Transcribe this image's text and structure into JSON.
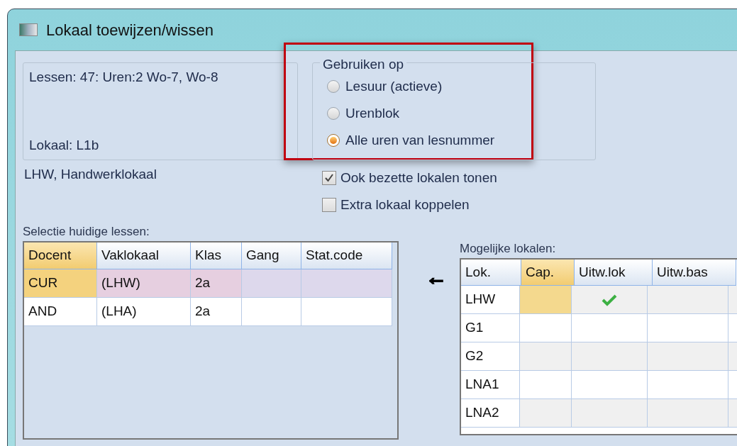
{
  "window": {
    "title": "Lokaal toewijzen/wissen"
  },
  "info": {
    "lessons": "Lessen: 47: Uren:2 Wo-7, Wo-8",
    "room": "Lokaal: L1b",
    "room_description": "LHW, Handwerklokaal"
  },
  "apply_group": {
    "legend": "Gebruiken op",
    "highlighted": true,
    "options": [
      {
        "label": "Lesuur (actieve)",
        "selected": false
      },
      {
        "label": "Urenblok",
        "selected": false
      },
      {
        "label": "Alle uren van lesnummer",
        "selected": true
      }
    ]
  },
  "checkboxes": [
    {
      "label": "Ook bezette lokalen tonen",
      "checked": true
    },
    {
      "label": "Extra lokaal koppelen",
      "checked": false
    }
  ],
  "current_lessons": {
    "label": "Selectie huidige lessen:",
    "columns": [
      {
        "label": "Docent",
        "sorted": true
      },
      {
        "label": "Vaklokaal",
        "sorted": false
      },
      {
        "label": "Klas",
        "sorted": false
      },
      {
        "label": "Gang",
        "sorted": false
      },
      {
        "label": "Stat.code",
        "sorted": false
      }
    ],
    "rows": [
      {
        "cells": [
          "CUR",
          "(LHW)",
          "2a",
          "",
          ""
        ],
        "selected": true
      },
      {
        "cells": [
          "AND",
          "(LHA)",
          "2a",
          "",
          ""
        ],
        "selected": false
      }
    ]
  },
  "transfer_arrow": "←",
  "possible_rooms": {
    "label": "Mogelijke lokalen:",
    "columns": [
      {
        "label": "Lok.",
        "sorted": false
      },
      {
        "label": "Cap.",
        "sorted": true
      },
      {
        "label": "Uitw.lok",
        "sorted": false
      },
      {
        "label": "Uitw.bas",
        "sorted": false
      }
    ],
    "rows": [
      {
        "room": "LHW",
        "current": true,
        "uitw_lok": true
      },
      {
        "room": "G1",
        "current": false,
        "uitw_lok": false
      },
      {
        "room": "G2",
        "current": false,
        "uitw_lok": false
      },
      {
        "room": "LNA1",
        "current": false,
        "uitw_lok": false
      },
      {
        "room": "LNA2",
        "current": false,
        "uitw_lok": false
      }
    ]
  }
}
